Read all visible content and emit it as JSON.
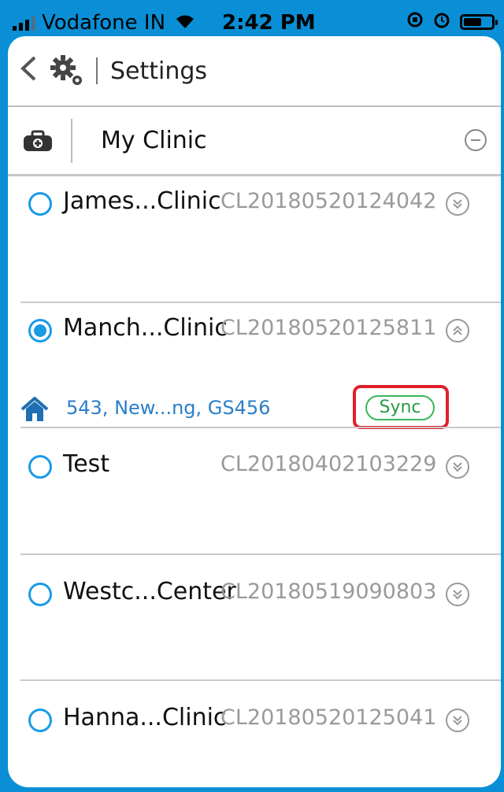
{
  "status_bar": {
    "carrier": "Vodafone IN",
    "time": "2:42 PM",
    "icons": [
      "signal-icon",
      "wifi-icon",
      "orientation-lock-icon",
      "alarm-icon",
      "battery-icon"
    ]
  },
  "header": {
    "title": "Settings",
    "icons": [
      "back-chevron-icon",
      "gears-icon"
    ]
  },
  "clinic_section": {
    "label": "My Clinic",
    "icon": "clinic-bag-icon",
    "action_icon": "collapse-minus-icon"
  },
  "clinics": [
    {
      "name": "James...Clinic",
      "code": "CL20180520124042",
      "selected": false,
      "expanded": false
    },
    {
      "name": "Manch...Clinic",
      "code": "CL20180520125811",
      "selected": true,
      "expanded": true,
      "address": "543, New...ng, GS456",
      "sync_label": "Sync"
    },
    {
      "name": "Test",
      "code": "CL20180402103229",
      "selected": false,
      "expanded": false
    },
    {
      "name": "Westc...Center",
      "code": "CL20180519090803",
      "selected": false,
      "expanded": false
    },
    {
      "name": "Hanna...Clinic",
      "code": "CL20180520125041",
      "selected": false,
      "expanded": false
    }
  ],
  "colors": {
    "accent_blue": "#1a9be6",
    "sync_green": "#3bb55a",
    "highlight_red": "#e01f2a",
    "frame_blue": "#0a8fd6"
  }
}
